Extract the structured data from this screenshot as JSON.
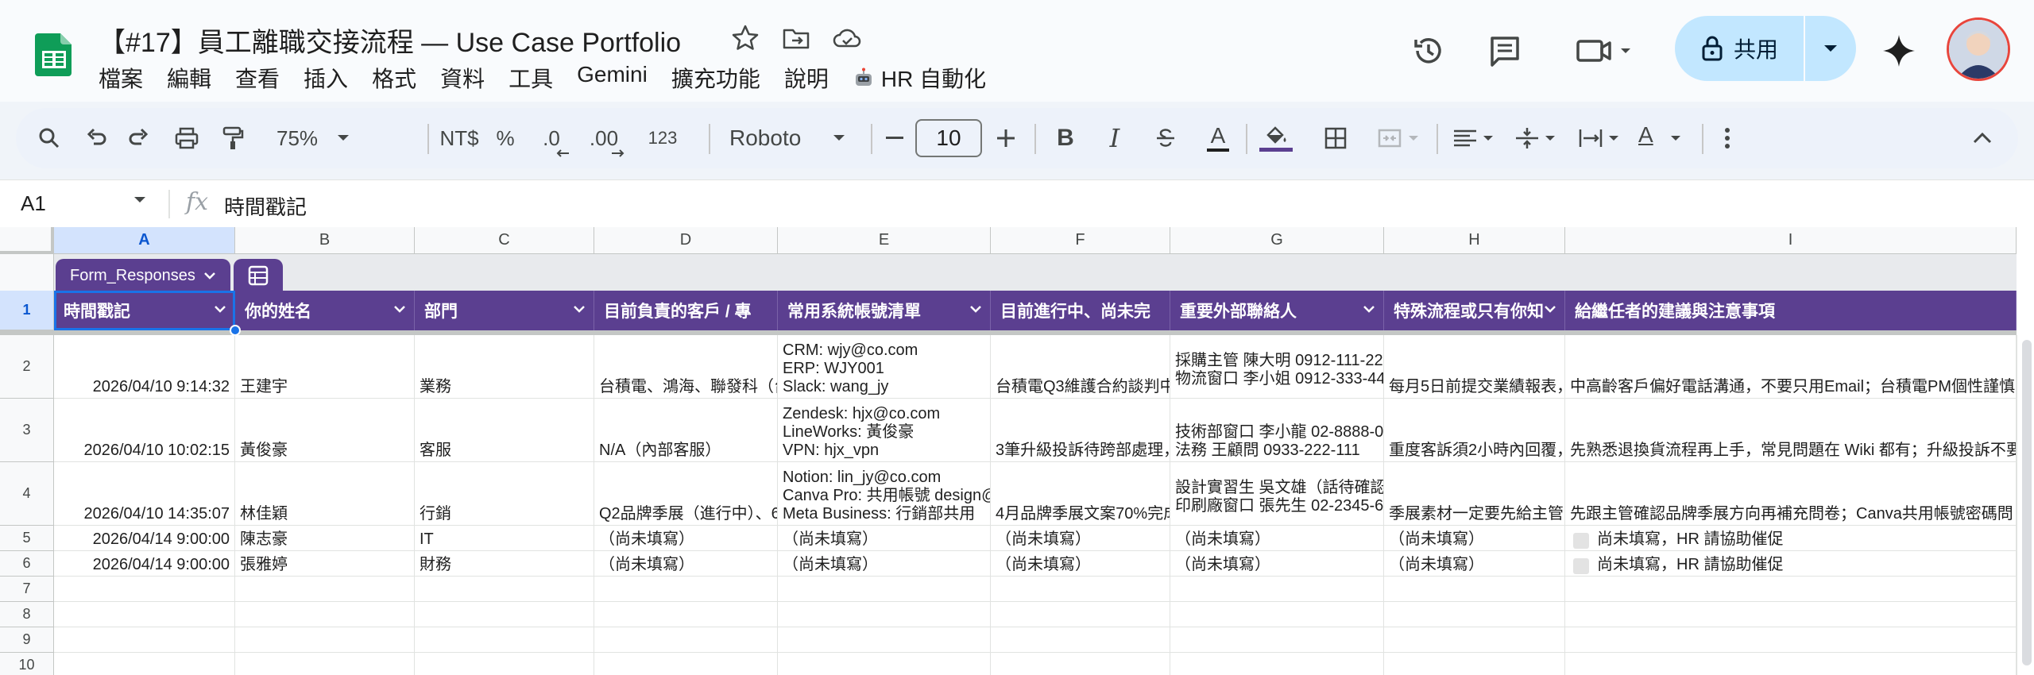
{
  "doc": {
    "title": "【#17】員工離職交接流程 — Use Case Portfolio",
    "menus": [
      "檔案",
      "編輯",
      "查看",
      "插入",
      "格式",
      "資料",
      "工具",
      "Gemini",
      "擴充功能",
      "說明"
    ],
    "hr_menu": "HR 自動化",
    "share_label": "共用"
  },
  "toolbar": {
    "zoom": "75%",
    "currency": "NT$",
    "percent": "%",
    "dec_decrease": ".0",
    "dec_increase": ".00",
    "number_format": "123",
    "font": "Roboto",
    "font_size": "10",
    "bold": "B",
    "italic": "I",
    "text_color_letter": "A",
    "text_rotate_letter": "A"
  },
  "formula_bar": {
    "cell_ref": "A1",
    "fx": "fx",
    "content": "時間戳記"
  },
  "grid": {
    "columns": [
      "A",
      "B",
      "C",
      "D",
      "E",
      "F",
      "G",
      "H",
      "I"
    ],
    "rows": [
      "1",
      "2",
      "3",
      "4",
      "5",
      "6",
      "7",
      "8",
      "9",
      "10"
    ],
    "table_name": "Form_Responses",
    "headers": [
      "時間戳記",
      "你的姓名",
      "部門",
      "目前負責的客戶 / 專",
      "常用系統帳號清單",
      "目前進行中、尚未完",
      "重要外部聯絡人",
      "特殊流程或只有你知",
      "給繼任者的建議與注意事項"
    ],
    "data": [
      {
        "ts": "2026/04/10 9:14:32",
        "name": "王建宇",
        "dept": "業務",
        "clients": "台積電、鴻海、聯發科（台",
        "accounts": [
          "CRM: wjy@co.com",
          "ERP: WJY001",
          "Slack: wang_jy"
        ],
        "pending": "台積電Q3維護合約談判中",
        "contacts": [
          "採購主管 陳大明 0912-111-222",
          "物流窗口 李小姐 0912-333-444"
        ],
        "special": "每月5日前提交業績報表，",
        "advice": "中高齡客戶偏好電話溝通，不要只用Email；台積電PM個性謹慎"
      },
      {
        "ts": "2026/04/10 10:02:15",
        "name": "黃俊豪",
        "dept": "客服",
        "clients": "N/A（內部客服）",
        "accounts": [
          "Zendesk: hjx@co.com",
          "LineWorks: 黃俊豪",
          "VPN: hjx_vpn"
        ],
        "pending": "3筆升級投訴待跨部處理，",
        "contacts": [
          "技術部窗口 李小龍 02-8888-0",
          "法務 王顧問 0933-222-111"
        ],
        "special": "重度客訴須2小時內回覆，",
        "advice": "先熟悉退換貨流程再上手，常見問題在 Wiki 都有；升級投訴不要"
      },
      {
        "ts": "2026/04/10 14:35:07",
        "name": "林佳穎",
        "dept": "行銷",
        "clients": "Q2品牌季展（進行中）、6",
        "accounts": [
          "Notion: lin_jy@co.com",
          "Canva Pro: 共用帳號 design@",
          "Meta Business: 行銷部共用"
        ],
        "pending": "4月品牌季展文案70%完成",
        "contacts": [
          "設計實習生 吳文雄（話待確認",
          "印刷廠窗口 張先生 02-2345-6"
        ],
        "special": "季展素材一定要先給主管",
        "advice": "先跟主管確認品牌季展方向再補充問卷；Canva共用帳號密碼問"
      },
      {
        "ts": "2026/04/14 9:00:00",
        "name": "陳志豪",
        "dept": "IT",
        "clients": "（尚未填寫）",
        "accounts": [
          "（尚未填寫）"
        ],
        "pending": "（尚未填寫）",
        "contacts": [
          "（尚未填寫）"
        ],
        "special": "（尚未填寫）",
        "advice": "尚未填寫，HR 請協助催促"
      },
      {
        "ts": "2026/04/14 9:00:00",
        "name": "張雅婷",
        "dept": "財務",
        "clients": "（尚未填寫）",
        "accounts": [
          "（尚未填寫）"
        ],
        "pending": "（尚未填寫）",
        "contacts": [
          "（尚未填寫）"
        ],
        "special": "（尚未填寫）",
        "advice": "尚未填寫，HR 請協助催促"
      }
    ]
  },
  "colors": {
    "accent": "#5b3f90",
    "selection": "#1a73e8",
    "share": "#c2e7ff"
  },
  "icons": [
    "sheets-logo-icon",
    "star-icon",
    "move-folder-icon",
    "cloud-saved-icon",
    "history-icon",
    "comment-icon",
    "meet-icon",
    "lock-icon",
    "gemini-icon",
    "search-icon",
    "undo-icon",
    "redo-icon",
    "print-icon",
    "paint-format-icon",
    "strikethrough-icon",
    "fill-color-icon",
    "borders-icon",
    "merge-icon",
    "align-icon",
    "valign-icon",
    "wrap-icon",
    "more-icon",
    "collapse-icon"
  ]
}
